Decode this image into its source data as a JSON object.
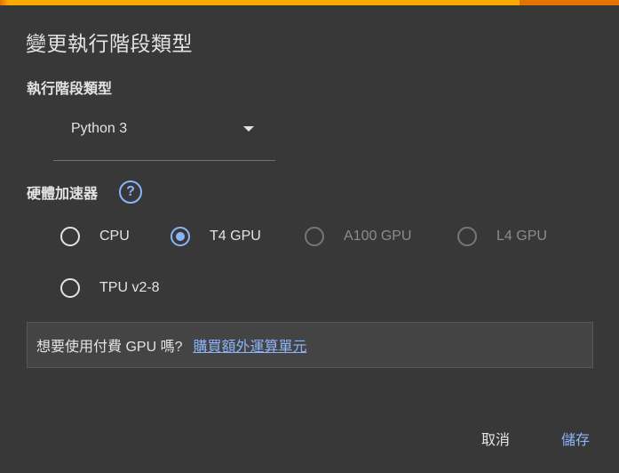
{
  "dialog": {
    "title": "變更執行階段類型",
    "runtime_type_label": "執行階段類型",
    "runtime_type": {
      "selected": "Python 3"
    },
    "hardware_accelerator_label": "硬體加速器",
    "help_icon": "?",
    "accelerators": [
      {
        "label": "CPU",
        "selected": false,
        "enabled": true
      },
      {
        "label": "T4 GPU",
        "selected": true,
        "enabled": true
      },
      {
        "label": "A100 GPU",
        "selected": false,
        "enabled": false
      },
      {
        "label": "L4 GPU",
        "selected": false,
        "enabled": false
      },
      {
        "label": "TPU v2-8",
        "selected": false,
        "enabled": true
      }
    ],
    "promo": {
      "text": "想要使用付費 GPU 嗎?",
      "link": "購買額外運算單元"
    },
    "buttons": {
      "cancel": "取消",
      "save": "儲存"
    }
  },
  "colors": {
    "background": "#383838",
    "accent": "#8ab4f8",
    "top_bar": "#f9ab00",
    "top_bar_edge": "#e37400",
    "disabled": "#8c8c8c"
  }
}
